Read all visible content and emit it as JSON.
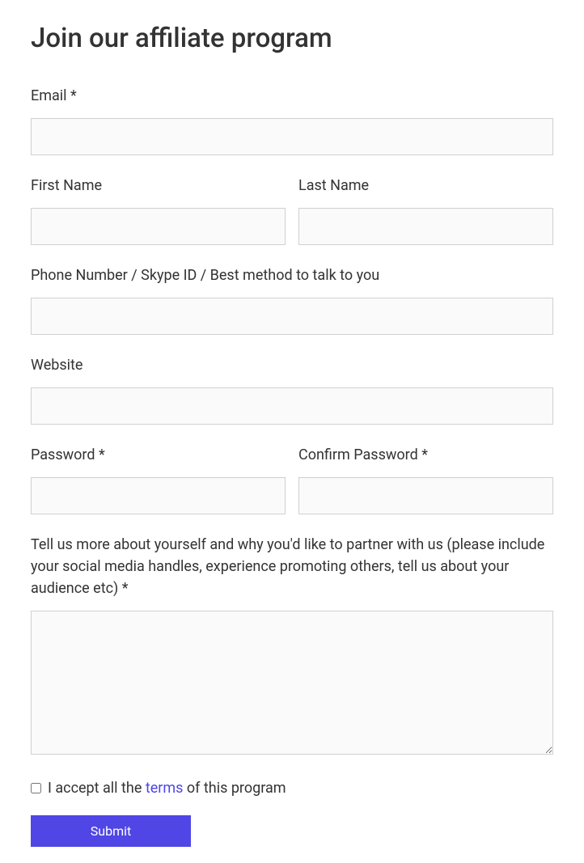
{
  "title": "Join our affiliate program",
  "fields": {
    "email_label": "Email *",
    "first_name_label": "First Name",
    "last_name_label": "Last Name",
    "phone_label": "Phone Number / Skype ID / Best method to talk to you",
    "website_label": "Website",
    "password_label": "Password *",
    "confirm_password_label": "Confirm Password *",
    "about_label": "Tell us more about yourself and why you'd like to partner with us (please include your social media handles, experience promoting others, tell us about your audience etc) *"
  },
  "terms": {
    "prefix": "I accept all the ",
    "link_text": "terms",
    "suffix": " of this program"
  },
  "submit_label": "Submit"
}
